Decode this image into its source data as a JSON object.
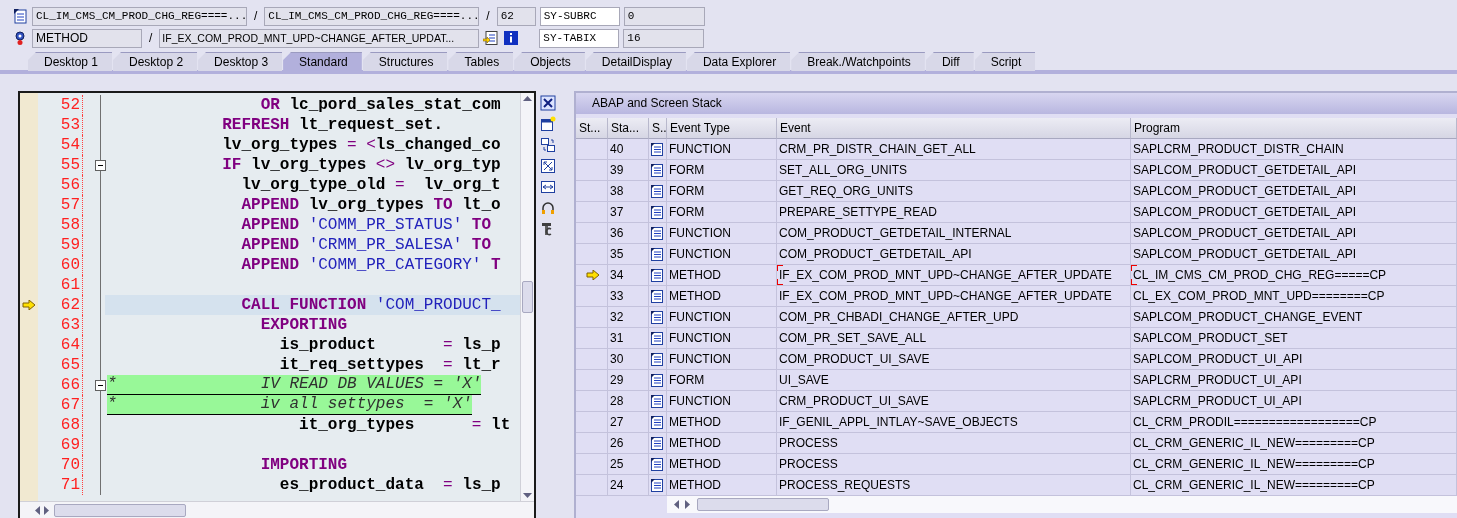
{
  "header": {
    "row_1": {
      "include": "CL_IM_CMS_CM_PROD_CHG_REG====...",
      "separator_1": "/",
      "program": "CL_IM_CMS_CM_PROD_CHG_REG====...",
      "separator_2": "/",
      "line": "62",
      "var_name": "SY-SUBRC",
      "var_value": "0"
    },
    "row_2": {
      "event_type": "METHOD",
      "separator": "/",
      "event": "IF_EX_COM_PROD_MNT_UPD~CHANGE_AFTER_UPDAT...",
      "var_name": "SY-TABIX",
      "var_value": "16"
    }
  },
  "tabs": [
    {
      "label": "Desktop 1",
      "selected": false
    },
    {
      "label": "Desktop 2",
      "selected": false
    },
    {
      "label": "Desktop 3",
      "selected": false
    },
    {
      "label": "Standard",
      "selected": true
    },
    {
      "label": "Structures",
      "selected": false
    },
    {
      "label": "Tables",
      "selected": false
    },
    {
      "label": "Objects",
      "selected": false
    },
    {
      "label": "DetailDisplay",
      "selected": false
    },
    {
      "label": "Data Explorer",
      "selected": false
    },
    {
      "label": "Break./Watchpoints",
      "selected": false
    },
    {
      "label": "Diff",
      "selected": false
    },
    {
      "label": "Script",
      "selected": false
    }
  ],
  "source": {
    "lines": [
      {
        "number": "52",
        "kind": "code",
        "current": false,
        "fold": false,
        "segments": [
          {
            "kind": "keyword",
            "text": "                OR"
          },
          {
            "kind": "ident",
            "text": " lc_pord_sales_stat_com"
          }
        ]
      },
      {
        "number": "53",
        "kind": "code",
        "current": false,
        "fold": false,
        "segments": [
          {
            "kind": "keyword",
            "text": "            REFRESH"
          },
          {
            "kind": "ident",
            "text": " lt_request_set."
          }
        ]
      },
      {
        "number": "54",
        "kind": "code",
        "current": false,
        "fold": false,
        "segments": [
          {
            "kind": "ident",
            "text": "            lv_org_types "
          },
          {
            "kind": "op",
            "text": "= <"
          },
          {
            "kind": "ident",
            "text": "ls_changed_co"
          }
        ]
      },
      {
        "number": "55",
        "kind": "code",
        "current": false,
        "fold": true,
        "segments": [
          {
            "kind": "keyword",
            "text": "            IF"
          },
          {
            "kind": "ident",
            "text": " lv_org_types "
          },
          {
            "kind": "op",
            "text": "<>"
          },
          {
            "kind": "ident",
            "text": " lv_org_typ"
          }
        ]
      },
      {
        "number": "56",
        "kind": "code",
        "current": false,
        "fold": false,
        "segments": [
          {
            "kind": "ident",
            "text": "              lv_org_type_old "
          },
          {
            "kind": "op",
            "text": "="
          },
          {
            "kind": "ident",
            "text": "  lv_org_t"
          }
        ]
      },
      {
        "number": "57",
        "kind": "code",
        "current": false,
        "fold": false,
        "segments": [
          {
            "kind": "keyword",
            "text": "              APPEND"
          },
          {
            "kind": "ident",
            "text": " lv_org_types "
          },
          {
            "kind": "keyword",
            "text": "TO"
          },
          {
            "kind": "ident",
            "text": " lt_o"
          }
        ]
      },
      {
        "number": "58",
        "kind": "code",
        "current": false,
        "fold": false,
        "segments": [
          {
            "kind": "keyword",
            "text": "              APPEND"
          },
          {
            "kind": "string",
            "text": " 'COMM_PR_STATUS'"
          },
          {
            "kind": "keyword",
            "text": " TO"
          }
        ]
      },
      {
        "number": "59",
        "kind": "code",
        "current": false,
        "fold": false,
        "segments": [
          {
            "kind": "keyword",
            "text": "              APPEND"
          },
          {
            "kind": "string",
            "text": " 'CRMM_PR_SALESA'"
          },
          {
            "kind": "keyword",
            "text": " TO"
          }
        ]
      },
      {
        "number": "60",
        "kind": "code",
        "current": false,
        "fold": false,
        "segments": [
          {
            "kind": "keyword",
            "text": "              APPEND"
          },
          {
            "kind": "string",
            "text": " 'COMM_PR_CATEGORY'"
          },
          {
            "kind": "keyword",
            "text": " T"
          }
        ]
      },
      {
        "number": "61",
        "current": false,
        "fold": false
      },
      {
        "number": "62",
        "kind": "code",
        "current": true,
        "fold": false,
        "segments": [
          {
            "kind": "keyword",
            "text": "              CALL FUNCTION"
          },
          {
            "kind": "string",
            "text": " 'COM_PRODUCT_"
          }
        ]
      },
      {
        "number": "63",
        "kind": "code",
        "current": false,
        "fold": false,
        "segments": [
          {
            "kind": "keyword",
            "text": "                EXPORTING"
          }
        ]
      },
      {
        "number": "64",
        "kind": "code",
        "current": false,
        "fold": false,
        "segments": [
          {
            "kind": "ident",
            "text": "                  is_product       "
          },
          {
            "kind": "op",
            "text": "="
          },
          {
            "kind": "ident",
            "text": " ls_p"
          }
        ]
      },
      {
        "number": "65",
        "kind": "code",
        "current": false,
        "fold": false,
        "segments": [
          {
            "kind": "ident",
            "text": "                  it_req_settypes  "
          },
          {
            "kind": "op",
            "text": "="
          },
          {
            "kind": "ident",
            "text": " lt_r"
          }
        ]
      },
      {
        "number": "66",
        "kind": "comment",
        "current": false,
        "fold": true,
        "segments": [
          {
            "kind": "comment",
            "text": "*               IV READ DB VALUES = 'X'"
          }
        ]
      },
      {
        "number": "67",
        "kind": "comment",
        "current": false,
        "fold": false,
        "segments": [
          {
            "kind": "comment",
            "text": "*               iv all settypes  = 'X'"
          }
        ]
      },
      {
        "number": "68",
        "kind": "code",
        "current": false,
        "fold": false,
        "segments": [
          {
            "kind": "ident",
            "text": "                    it_org_types      "
          },
          {
            "kind": "op",
            "text": "="
          },
          {
            "kind": "ident",
            "text": " lt"
          }
        ]
      },
      {
        "number": "69",
        "current": false,
        "fold": false
      },
      {
        "number": "70",
        "kind": "code",
        "current": false,
        "fold": false,
        "segments": [
          {
            "kind": "keyword",
            "text": "                IMPORTING"
          }
        ]
      },
      {
        "number": "71",
        "kind": "code",
        "current": false,
        "fold": false,
        "segments": [
          {
            "kind": "ident",
            "text": "                  es_product_data  "
          },
          {
            "kind": "op",
            "text": "="
          },
          {
            "kind": "ident",
            "text": " ls_p"
          }
        ]
      }
    ]
  },
  "stack": {
    "title": "ABAP and Screen Stack",
    "columns": [
      "St...",
      "Sta...",
      "S..",
      "Event Type",
      "Event",
      "Program"
    ],
    "rows": [
      {
        "level": "40",
        "event_type": "FUNCTION",
        "event": "CRM_PR_DISTR_CHAIN_GET_ALL",
        "program": "SAPLCRM_PRODUCT_DISTR_CHAIN",
        "selected": false
      },
      {
        "level": "39",
        "event_type": "FORM",
        "event": "SET_ALL_ORG_UNITS",
        "program": "SAPLCOM_PRODUCT_GETDETAIL_API",
        "selected": false
      },
      {
        "level": "38",
        "event_type": "FORM",
        "event": "GET_REQ_ORG_UNITS",
        "program": "SAPLCOM_PRODUCT_GETDETAIL_API",
        "selected": false
      },
      {
        "level": "37",
        "event_type": "FORM",
        "event": "PREPARE_SETTYPE_READ",
        "program": "SAPLCOM_PRODUCT_GETDETAIL_API",
        "selected": false
      },
      {
        "level": "36",
        "event_type": "FUNCTION",
        "event": "COM_PRODUCT_GETDETAIL_INTERNAL",
        "program": "SAPLCOM_PRODUCT_GETDETAIL_API",
        "selected": false
      },
      {
        "level": "35",
        "event_type": "FUNCTION",
        "event": "COM_PRODUCT_GETDETAIL_API",
        "program": "SAPLCOM_PRODUCT_GETDETAIL_API",
        "selected": false
      },
      {
        "level": "34",
        "event_type": "METHOD",
        "event": "IF_EX_COM_PROD_MNT_UPD~CHANGE_AFTER_UPDATE",
        "program": "CL_IM_CMS_CM_PROD_CHG_REG=====CP",
        "selected": true
      },
      {
        "level": "33",
        "event_type": "METHOD",
        "event": "IF_EX_COM_PROD_MNT_UPD~CHANGE_AFTER_UPDATE",
        "program": "CL_EX_COM_PROD_MNT_UPD========CP",
        "selected": false
      },
      {
        "level": "32",
        "event_type": "FUNCTION",
        "event": "COM_PR_CHBADI_CHANGE_AFTER_UPD",
        "program": "SAPLCOM_PRODUCT_CHANGE_EVENT",
        "selected": false
      },
      {
        "level": "31",
        "event_type": "FUNCTION",
        "event": "COM_PR_SET_SAVE_ALL",
        "program": "SAPLCOM_PRODUCT_SET",
        "selected": false
      },
      {
        "level": "30",
        "event_type": "FUNCTION",
        "event": "COM_PRODUCT_UI_SAVE",
        "program": "SAPLCOM_PRODUCT_UI_API",
        "selected": false
      },
      {
        "level": "29",
        "event_type": "FORM",
        "event": "UI_SAVE",
        "program": "SAPLCRM_PRODUCT_UI_API",
        "selected": false
      },
      {
        "level": "28",
        "event_type": "FUNCTION",
        "event": "CRM_PRODUCT_UI_SAVE",
        "program": "SAPLCRM_PRODUCT_UI_API",
        "selected": false
      },
      {
        "level": "27",
        "event_type": "METHOD",
        "event": "IF_GENIL_APPL_INTLAY~SAVE_OBJECTS",
        "program": "CL_CRM_PRODIL==================CP",
        "selected": false
      },
      {
        "level": "26",
        "event_type": "METHOD",
        "event": "PROCESS",
        "program": "CL_CRM_GENERIC_IL_NEW=========CP",
        "selected": false
      },
      {
        "level": "25",
        "event_type": "METHOD",
        "event": "PROCESS",
        "program": "CL_CRM_GENERIC_IL_NEW=========CP",
        "selected": false
      },
      {
        "level": "24",
        "event_type": "METHOD",
        "event": "PROCESS_REQUESTS",
        "program": "CL_CRM_GENERIC_IL_NEW=========CP",
        "selected": false
      }
    ]
  }
}
